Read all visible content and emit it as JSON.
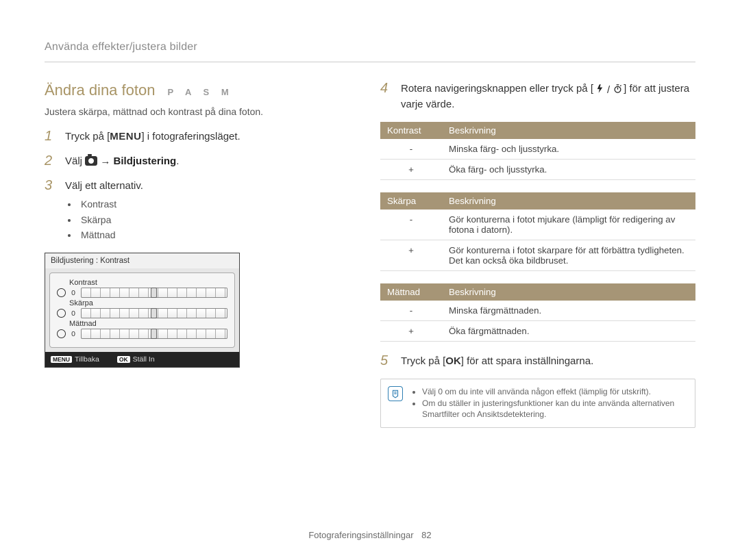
{
  "breadcrumb": "Använda effekter/justera bilder",
  "title": "Ändra dina foton",
  "modes": "P A S M",
  "subtitle": "Justera skärpa, mättnad och kontrast på dina foton.",
  "steps": {
    "s1": {
      "num": "1",
      "before": "Tryck på [",
      "key": "MENU",
      "after": "] i fotograferingsläget."
    },
    "s2": {
      "num": "2",
      "before": "Välj ",
      "after": " → ",
      "bold": "Bildjustering",
      "end": "."
    },
    "s3": {
      "num": "3",
      "text": "Välj ett alternativ.",
      "bullets": [
        "Kontrast",
        "Skärpa",
        "Mättnad"
      ]
    },
    "s4": {
      "num": "4",
      "before": "Rotera navigeringsknappen eller tryck på [",
      "sep": "/",
      "after": "] för att justera varje värde."
    },
    "s5": {
      "num": "5",
      "before": "Tryck på [",
      "key": "OK",
      "after": "] för att spara inställningarna."
    }
  },
  "device": {
    "title": "Bildjustering : Kontrast",
    "rows": [
      {
        "label": "Kontrast",
        "value": "0"
      },
      {
        "label": "Skärpa",
        "value": "0"
      },
      {
        "label": "Mättnad",
        "value": "0"
      }
    ],
    "footer": {
      "back_key": "MENU",
      "back_label": "Tillbaka",
      "set_key": "OK",
      "set_label": "Ställ In"
    }
  },
  "tables": {
    "contrast": {
      "h1": "Kontrast",
      "h2": "Beskrivning",
      "rows": [
        {
          "sym": "-",
          "desc": "Minska färg- och ljusstyrka."
        },
        {
          "sym": "+",
          "desc": "Öka färg- och ljusstyrka."
        }
      ]
    },
    "sharp": {
      "h1": "Skärpa",
      "h2": "Beskrivning",
      "rows": [
        {
          "sym": "-",
          "desc": "Gör konturerna i fotot mjukare (lämpligt för redigering av fotona i datorn)."
        },
        {
          "sym": "+",
          "desc": "Gör konturerna i fotot skarpare för att förbättra tydligheten. Det kan också öka bildbruset."
        }
      ]
    },
    "sat": {
      "h1": "Mättnad",
      "h2": "Beskrivning",
      "rows": [
        {
          "sym": "-",
          "desc": "Minska färgmättnaden."
        },
        {
          "sym": "+",
          "desc": "Öka färgmättnaden."
        }
      ]
    }
  },
  "note": {
    "items": [
      "Välj 0 om du inte vill använda någon effekt (lämplig för utskrift).",
      "Om du ställer in justeringsfunktioner kan du inte använda alternativen Smartfilter och Ansiktsdetektering."
    ]
  },
  "footer": {
    "section": "Fotograferingsinställningar",
    "page": "82"
  }
}
